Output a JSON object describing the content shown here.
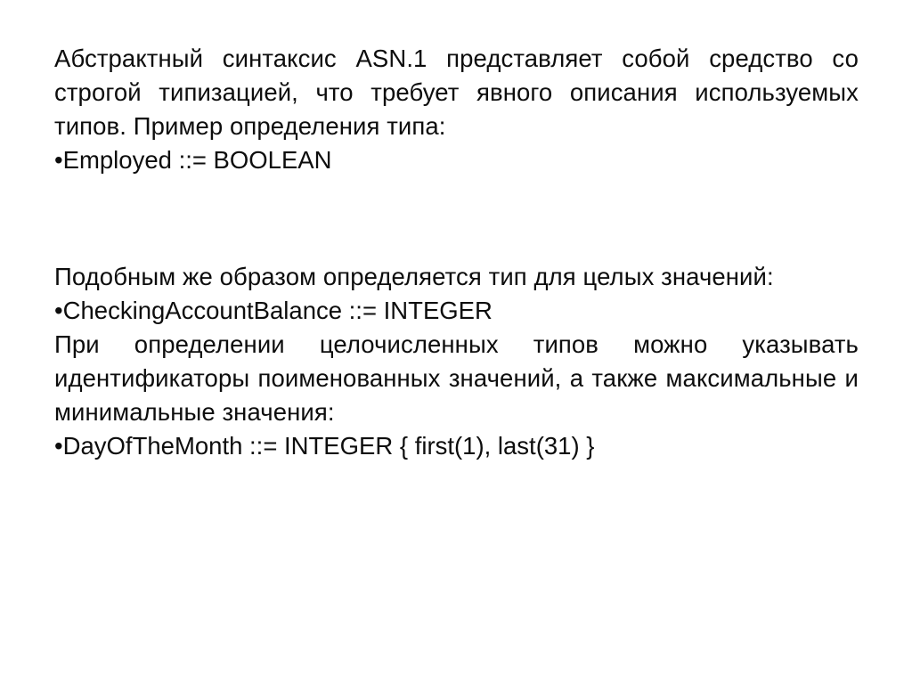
{
  "slide": {
    "background_color": "#ffffff",
    "text_color": "#0d0d0d",
    "bullet_glyph": "•",
    "blocks": [
      {
        "kind": "paragraph",
        "text": "Абстрактный синтаксис ASN.1 представляет собой средство со строгой типизацией, что требует явного описания используемых типов. Пример определения типа:"
      },
      {
        "kind": "bullet",
        "text": "Employed ::= BOOLEAN"
      },
      {
        "kind": "blank",
        "text": ""
      },
      {
        "kind": "paragraph",
        "text": "Подобным же образом определяется тип для целых значений:"
      },
      {
        "kind": "bullet",
        "text": "CheckingAccountBalance ::= INTEGER"
      },
      {
        "kind": "paragraph",
        "text": "При определении целочисленных типов можно указывать идентификаторы поименованных значений, а также максимальные и минимальные значения:"
      },
      {
        "kind": "bullet",
        "text": "DayOfTheMonth ::= INTEGER { first(1), last(31) }"
      }
    ]
  }
}
